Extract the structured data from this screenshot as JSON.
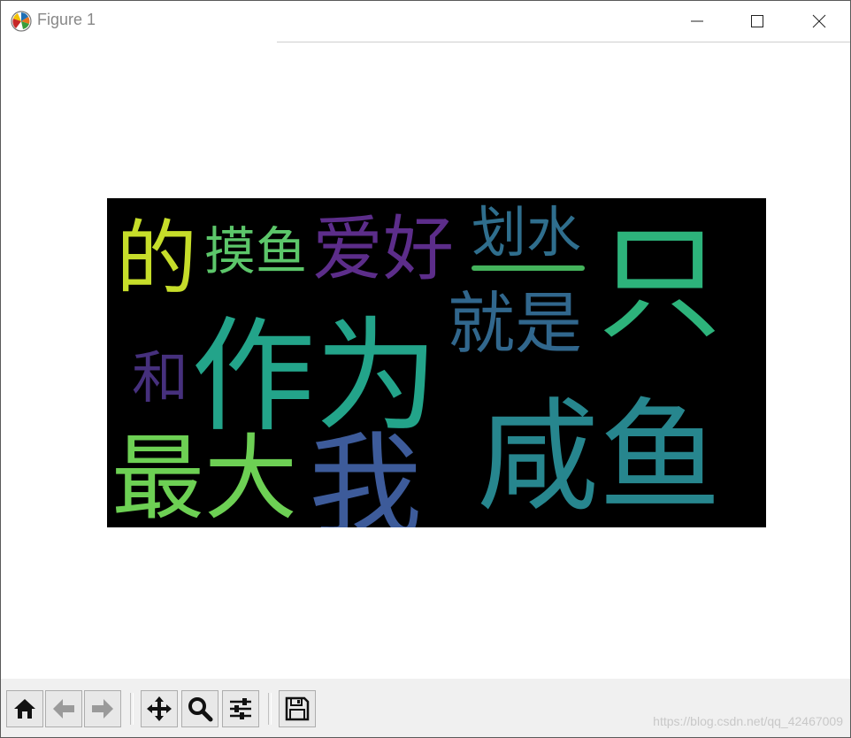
{
  "window": {
    "title": "Figure 1",
    "icons": [
      "matplotlib-icon",
      "minimize-icon",
      "maximize-icon",
      "close-icon"
    ]
  },
  "wordcloud": {
    "background": "#000000",
    "words": [
      {
        "text": "的",
        "color": "#c6dd2a"
      },
      {
        "text": "摸鱼",
        "color": "#5cc66a"
      },
      {
        "text": "爱好",
        "color": "#5c2d8a"
      },
      {
        "text": "划水",
        "color": "#2f6e8d"
      },
      {
        "text": "只",
        "color": "#2db37b"
      },
      {
        "text": "作为",
        "color": "#23a48a"
      },
      {
        "text": "就是",
        "color": "#31678d"
      },
      {
        "text": "和",
        "color": "#46307d"
      },
      {
        "text": "最大",
        "color": "#6dd054"
      },
      {
        "text": "我",
        "color": "#3d5b9a"
      },
      {
        "text": "咸鱼",
        "color": "#27868e"
      }
    ]
  },
  "toolbar": {
    "buttons": [
      "home-icon",
      "back-icon",
      "forward-icon",
      "pan-icon",
      "zoom-icon",
      "configure-icon",
      "save-icon"
    ]
  },
  "watermark": "https://blog.csdn.net/qq_42467009"
}
